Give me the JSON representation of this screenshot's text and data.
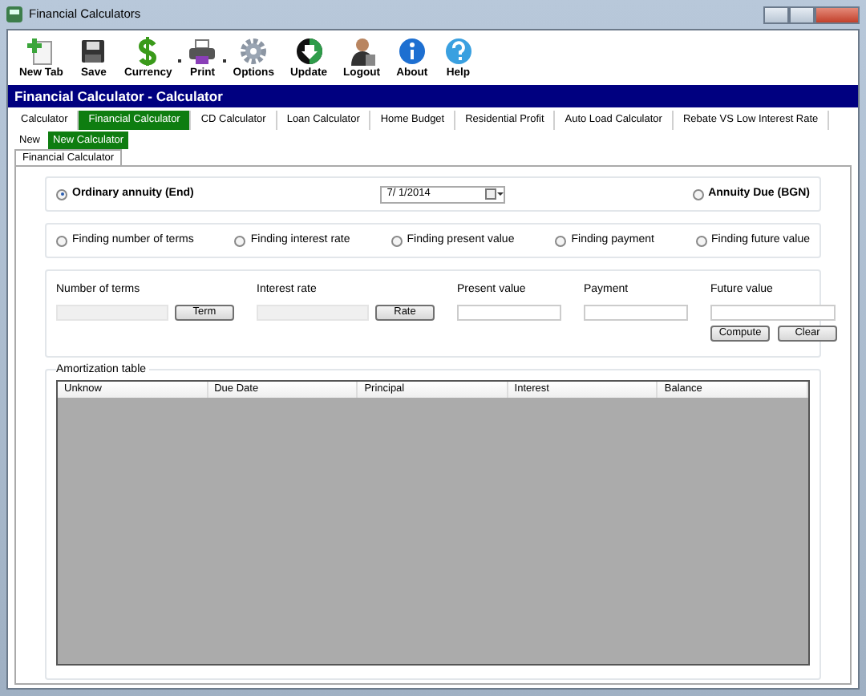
{
  "window": {
    "title": "Financial Calculators"
  },
  "toolbar": [
    {
      "label": "New Tab",
      "dropdown": false
    },
    {
      "label": "Save",
      "dropdown": false
    },
    {
      "label": "Currency",
      "dropdown": true
    },
    {
      "label": "Print",
      "dropdown": true
    },
    {
      "label": "Options",
      "dropdown": false
    },
    {
      "label": "Update",
      "dropdown": false
    },
    {
      "label": "Logout",
      "dropdown": false
    },
    {
      "label": "About",
      "dropdown": false
    },
    {
      "label": "Help",
      "dropdown": false
    }
  ],
  "header": {
    "title": "Financial Calculator - Calculator"
  },
  "tabs": [
    {
      "label": "Calculator",
      "selected": false
    },
    {
      "label": "Financial Calculator",
      "selected": true
    },
    {
      "label": "CD Calculator",
      "selected": false
    },
    {
      "label": "Loan Calculator",
      "selected": false
    },
    {
      "label": "Home Budget",
      "selected": false
    },
    {
      "label": "Residential Profit",
      "selected": false
    },
    {
      "label": "Auto Load Calculator",
      "selected": false
    },
    {
      "label": "Rebate VS Low Interest Rate",
      "selected": false
    }
  ],
  "subtabs": [
    {
      "label": "New",
      "selected": false
    },
    {
      "label": "New Calculator",
      "selected": true
    }
  ],
  "page_tab": {
    "label": "Financial Calculator"
  },
  "annuity": {
    "options": [
      {
        "label": "Ordinary annuity (End)",
        "selected": true
      },
      {
        "label": "Annuity Due (BGN)",
        "selected": false
      }
    ],
    "date": "7/  1/2014"
  },
  "finding": [
    {
      "label": "Finding number of terms",
      "selected": false
    },
    {
      "label": "Finding interest rate",
      "selected": false
    },
    {
      "label": "Finding present value",
      "selected": false
    },
    {
      "label": "Finding payment",
      "selected": false
    },
    {
      "label": "Finding future value",
      "selected": false
    }
  ],
  "inputs": [
    {
      "label": "Number of terms",
      "disabled": true,
      "button": "Term"
    },
    {
      "label": "Interest rate",
      "disabled": true,
      "button": "Rate"
    },
    {
      "label": "Present value",
      "disabled": false
    },
    {
      "label": "Payment",
      "disabled": false
    },
    {
      "label": "Future value",
      "disabled": false
    }
  ],
  "actions": [
    "Compute",
    "Clear"
  ],
  "amortization": {
    "title": "Amortization table",
    "columns": [
      "Unknow",
      "Due Date",
      "Principal",
      "Interest",
      "Balance"
    ]
  }
}
